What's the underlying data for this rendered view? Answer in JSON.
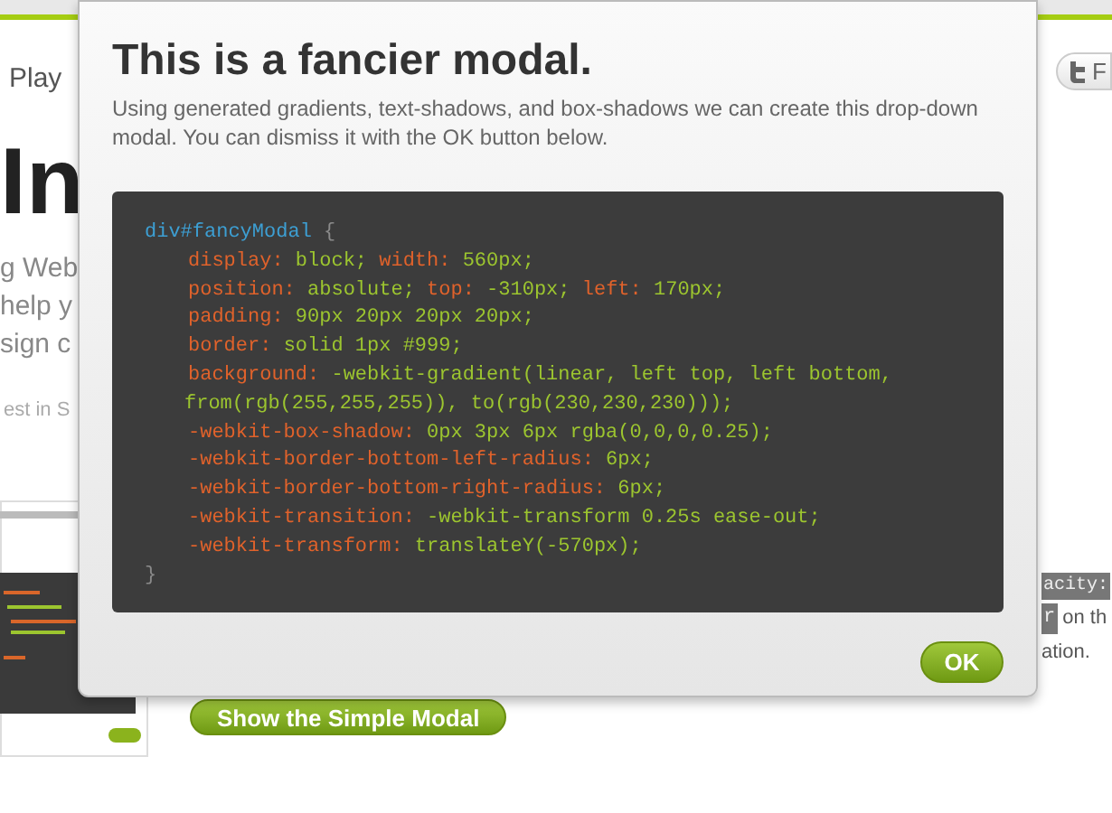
{
  "page": {
    "nav_text": "Play",
    "heading": "In",
    "intro_lines": [
      "g Web",
      "help y",
      "sign c"
    ],
    "note": "est in S",
    "twitter_button": "F",
    "right_code_1": "acity:",
    "right_code_2": "r",
    "right_text_1": "on th",
    "right_text_2": "ation.",
    "show_button": "Show the Simple Modal"
  },
  "modal": {
    "title": "This is a fancier modal.",
    "description": "Using generated gradients, text-shadows, and box-shadows we can create this drop-down modal. You can dismiss it with the OK button below.",
    "ok_button": "OK",
    "code_lines": [
      {
        "kind": "open",
        "tokens": [
          {
            "kind": "selector",
            "text": "div#fancyModal"
          },
          {
            "kind": "brace",
            "text": " {"
          }
        ]
      },
      {
        "kind": "decl",
        "tokens": [
          {
            "kind": "prop",
            "text": "display:"
          },
          {
            "kind": "value",
            "text": " block; "
          },
          {
            "kind": "prop",
            "text": "width:"
          },
          {
            "kind": "value",
            "text": " 560px;"
          }
        ]
      },
      {
        "kind": "decl",
        "tokens": [
          {
            "kind": "prop",
            "text": "position:"
          },
          {
            "kind": "value",
            "text": " absolute; "
          },
          {
            "kind": "prop",
            "text": "top:"
          },
          {
            "kind": "value",
            "text": " -310px; "
          },
          {
            "kind": "prop",
            "text": "left:"
          },
          {
            "kind": "value",
            "text": " 170px;"
          }
        ]
      },
      {
        "kind": "decl",
        "tokens": [
          {
            "kind": "prop",
            "text": "padding:"
          },
          {
            "kind": "value",
            "text": " 90px 20px 20px 20px;"
          }
        ]
      },
      {
        "kind": "decl",
        "tokens": [
          {
            "kind": "prop",
            "text": "border:"
          },
          {
            "kind": "value",
            "text": " solid 1px #999;"
          }
        ]
      },
      {
        "kind": "decl",
        "tokens": [
          {
            "kind": "prop",
            "text": "background:"
          },
          {
            "kind": "value",
            "text": " -webkit-gradient(linear, left top, left bottom,"
          }
        ]
      },
      {
        "kind": "wrap",
        "tokens": [
          {
            "kind": "value",
            "text": "from(rgb(255,255,255)), to(rgb(230,230,230)));"
          }
        ]
      },
      {
        "kind": "decl",
        "tokens": [
          {
            "kind": "prop",
            "text": "-webkit-box-shadow:"
          },
          {
            "kind": "value",
            "text": " 0px 3px 6px rgba(0,0,0,0.25);"
          }
        ]
      },
      {
        "kind": "decl",
        "tokens": [
          {
            "kind": "prop",
            "text": "-webkit-border-bottom-left-radius:"
          },
          {
            "kind": "value",
            "text": " 6px;"
          }
        ]
      },
      {
        "kind": "decl",
        "tokens": [
          {
            "kind": "prop",
            "text": "-webkit-border-bottom-right-radius:"
          },
          {
            "kind": "value",
            "text": " 6px;"
          }
        ]
      },
      {
        "kind": "decl",
        "tokens": [
          {
            "kind": "prop",
            "text": "-webkit-transition:"
          },
          {
            "kind": "value",
            "text": " -webkit-transform 0.25s ease-out;"
          }
        ]
      },
      {
        "kind": "decl",
        "tokens": [
          {
            "kind": "prop",
            "text": "-webkit-transform:"
          },
          {
            "kind": "value",
            "text": " translateY(-570px);"
          }
        ]
      },
      {
        "kind": "close",
        "tokens": [
          {
            "kind": "brace",
            "text": "}"
          }
        ]
      }
    ]
  }
}
